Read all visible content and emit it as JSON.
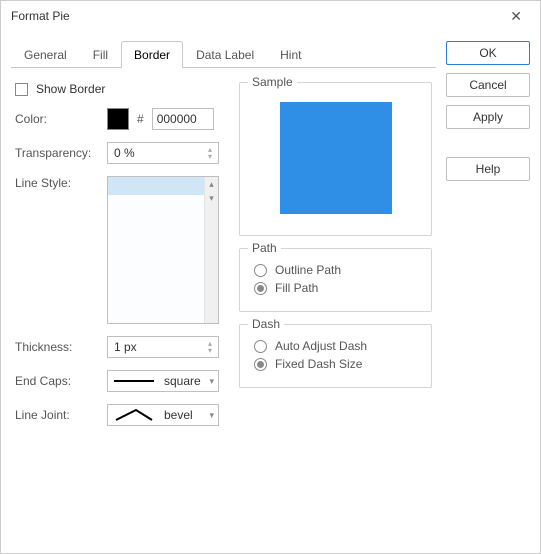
{
  "window": {
    "title": "Format Pie"
  },
  "buttons": {
    "ok": "OK",
    "cancel": "Cancel",
    "apply": "Apply",
    "help": "Help"
  },
  "tabs": [
    "General",
    "Fill",
    "Border",
    "Data Label",
    "Hint"
  ],
  "active_tab": "Border",
  "border": {
    "show_border_label": "Show Border",
    "show_border_checked": false,
    "color_label": "Color:",
    "color_hex": "000000",
    "color_swatch": "#000000",
    "transparency_label": "Transparency:",
    "transparency_value": "0 %",
    "line_style_label": "Line Style:",
    "thickness_label": "Thickness:",
    "thickness_value": "1 px",
    "end_caps_label": "End Caps:",
    "end_caps_value": "square",
    "line_joint_label": "Line Joint:",
    "line_joint_value": "bevel"
  },
  "sample": {
    "title": "Sample",
    "color": "#2f8fe6"
  },
  "path": {
    "title": "Path",
    "outline_label": "Outline Path",
    "fill_label": "Fill Path",
    "selected": "fill"
  },
  "dash": {
    "title": "Dash",
    "auto_label": "Auto Adjust Dash",
    "fixed_label": "Fixed Dash Size",
    "selected": "fixed"
  }
}
